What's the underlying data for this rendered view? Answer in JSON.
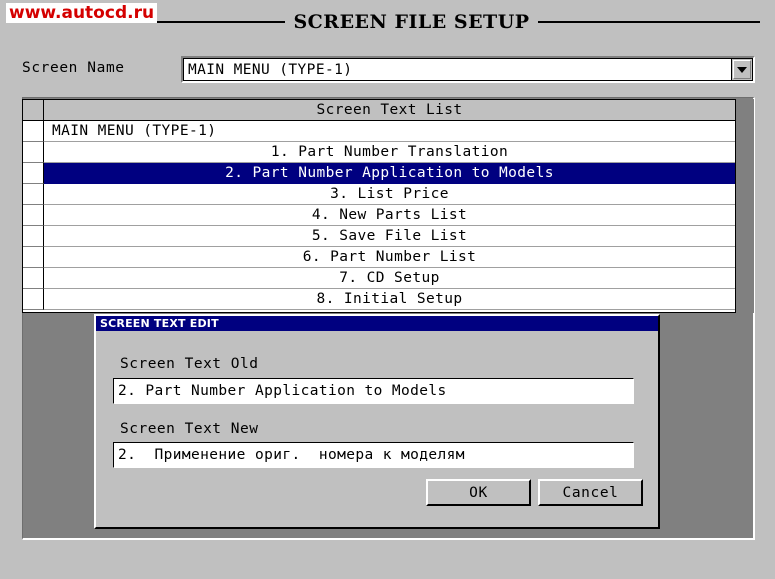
{
  "watermark": {
    "text": "www.autocd.ru",
    "color": "#d40000"
  },
  "header": {
    "title": "SCREEN FILE SETUP"
  },
  "screen_name": {
    "label": "Screen Name",
    "value": "MAIN MENU (TYPE-1)",
    "placeholder": "",
    "dropdown_icon": "chevron-down-icon"
  },
  "grid": {
    "header": "Screen Text List",
    "selected_index": 2,
    "highlight_color": "#000080",
    "rows": [
      {
        "text": "MAIN MENU (TYPE-1)",
        "align": "left",
        "selected": false
      },
      {
        "text": "1. Part Number Translation",
        "align": "center",
        "selected": false
      },
      {
        "text": "2. Part Number Application to Models",
        "align": "center",
        "selected": true
      },
      {
        "text": "3. List Price",
        "align": "center",
        "selected": false
      },
      {
        "text": "4. New Parts List",
        "align": "center",
        "selected": false
      },
      {
        "text": "5. Save File List",
        "align": "center",
        "selected": false
      },
      {
        "text": "6. Part Number List",
        "align": "center",
        "selected": false
      },
      {
        "text": "7. CD Setup",
        "align": "center",
        "selected": false
      },
      {
        "text": "8. Initial Setup",
        "align": "center",
        "selected": false
      }
    ]
  },
  "dialog": {
    "title": "SCREEN TEXT EDIT",
    "old_label": "Screen Text Old",
    "old_value": "2. Part Number Application to Models",
    "new_label": "Screen Text New",
    "new_value": "2.  Применение ориг.  номера к моделям",
    "ok_label": "OK",
    "cancel_label": "Cancel"
  }
}
